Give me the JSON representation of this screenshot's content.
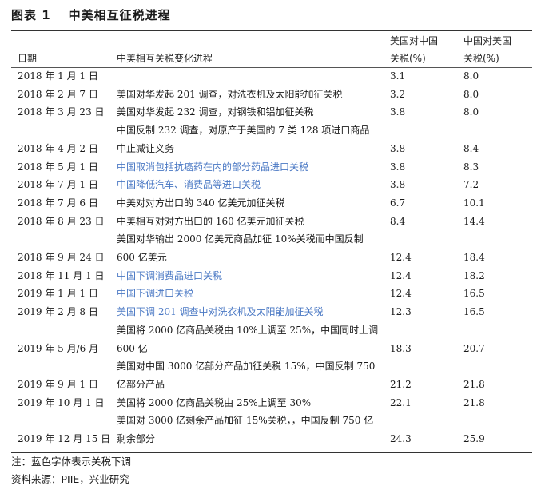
{
  "title": {
    "label": "图表 1",
    "text": "中美相互征税进程"
  },
  "headers": {
    "date": "日期",
    "desc": "中美相互关税变化进程",
    "us_line1": "美国对中国",
    "us_line2": "关税(%)",
    "cn_line1": "中国对美国",
    "cn_line2": "关税(%)"
  },
  "rows": [
    {
      "date": "2018 年 1 月 1 日",
      "desc": [],
      "us": "3.1",
      "cn": "8.0",
      "blue": false
    },
    {
      "date": "2018 年 2 月 7 日",
      "desc": [
        "美国对华发起 201 调查，对洗衣机及太阳能加征关税"
      ],
      "us": "3.2",
      "cn": "8.0",
      "blue": false
    },
    {
      "date": "2018 年 3 月 23 日",
      "desc": [
        "美国对华发起 232 调查，对钢铁和铝加征关税"
      ],
      "us": "3.8",
      "cn": "8.0",
      "blue": false
    },
    {
      "date": "2018 年 4 月 2 日",
      "desc": [
        "中国反制 232 调查，对原产于美国的 7 类 128 项进口商品",
        "中止减让义务"
      ],
      "us": "3.8",
      "cn": "8.4",
      "blue": false
    },
    {
      "date": "2018 年 5 月 1 日",
      "desc": [
        "中国取消包括抗癌药在内的部分药品进口关税"
      ],
      "us": "3.8",
      "cn": "8.3",
      "blue": true
    },
    {
      "date": "2018 年 7 月 1 日",
      "desc": [
        "中国降低汽车、消费品等进口关税"
      ],
      "us": "3.8",
      "cn": "7.2",
      "blue": true
    },
    {
      "date": "2018 年 7 月 6 日",
      "desc": [
        "中美对对方出口的 340 亿美元加征关税"
      ],
      "us": "6.7",
      "cn": "10.1",
      "blue": false
    },
    {
      "date": "2018 年 8 月 23 日",
      "desc": [
        "中美相互对对方出口的 160 亿美元加征关税"
      ],
      "us": "8.4",
      "cn": "14.4",
      "blue": false
    },
    {
      "date": "2018 年 9 月 24 日",
      "desc": [
        "美国对华输出 2000 亿美元商品加征 10%关税而中国反制",
        "600 亿美元"
      ],
      "us": "12.4",
      "cn": "18.4",
      "blue": false
    },
    {
      "date": "2018 年 11 月 1 日",
      "desc": [
        "中国下调消费品进口关税"
      ],
      "us": "12.4",
      "cn": "18.2",
      "blue": true
    },
    {
      "date": "2019 年 1 月 1 日",
      "desc": [
        "中国下调进口关税"
      ],
      "us": "12.4",
      "cn": "16.5",
      "blue": true
    },
    {
      "date": "2019 年 2 月 8 日",
      "desc": [
        "美国下调 201 调查中对洗衣机及太阳能加征关税"
      ],
      "us": "12.3",
      "cn": "16.5",
      "blue": true
    },
    {
      "date": "2019 年 5 月/6 月",
      "desc": [
        "美国将 2000 亿商品关税由 10%上调至 25%，中国同时上调",
        "600 亿"
      ],
      "us": "18.3",
      "cn": "20.7",
      "blue": false
    },
    {
      "date": "2019 年 9 月 1 日",
      "desc": [
        "美国对中国 3000 亿部分产品加征关税 15%，中国反制 750",
        "亿部分产品"
      ],
      "us": "21.2",
      "cn": "21.8",
      "blue": false
    },
    {
      "date": "2019 年 10 月 1 日",
      "desc": [
        "美国将 2000 亿商品关税由 25%上调至 30%"
      ],
      "us": "22.1",
      "cn": "21.8",
      "blue": false
    },
    {
      "date": "2019 年 12 月 15 日",
      "desc": [
        "美国对 3000 亿剩余产品加征 15%关税，，中国反制 750 亿",
        "剩余部分"
      ],
      "us": "24.3",
      "cn": "25.9",
      "blue": false
    }
  ],
  "notes": {
    "note": "注：蓝色字体表示关税下调",
    "source": "资料来源：PIIE，兴业研究"
  }
}
